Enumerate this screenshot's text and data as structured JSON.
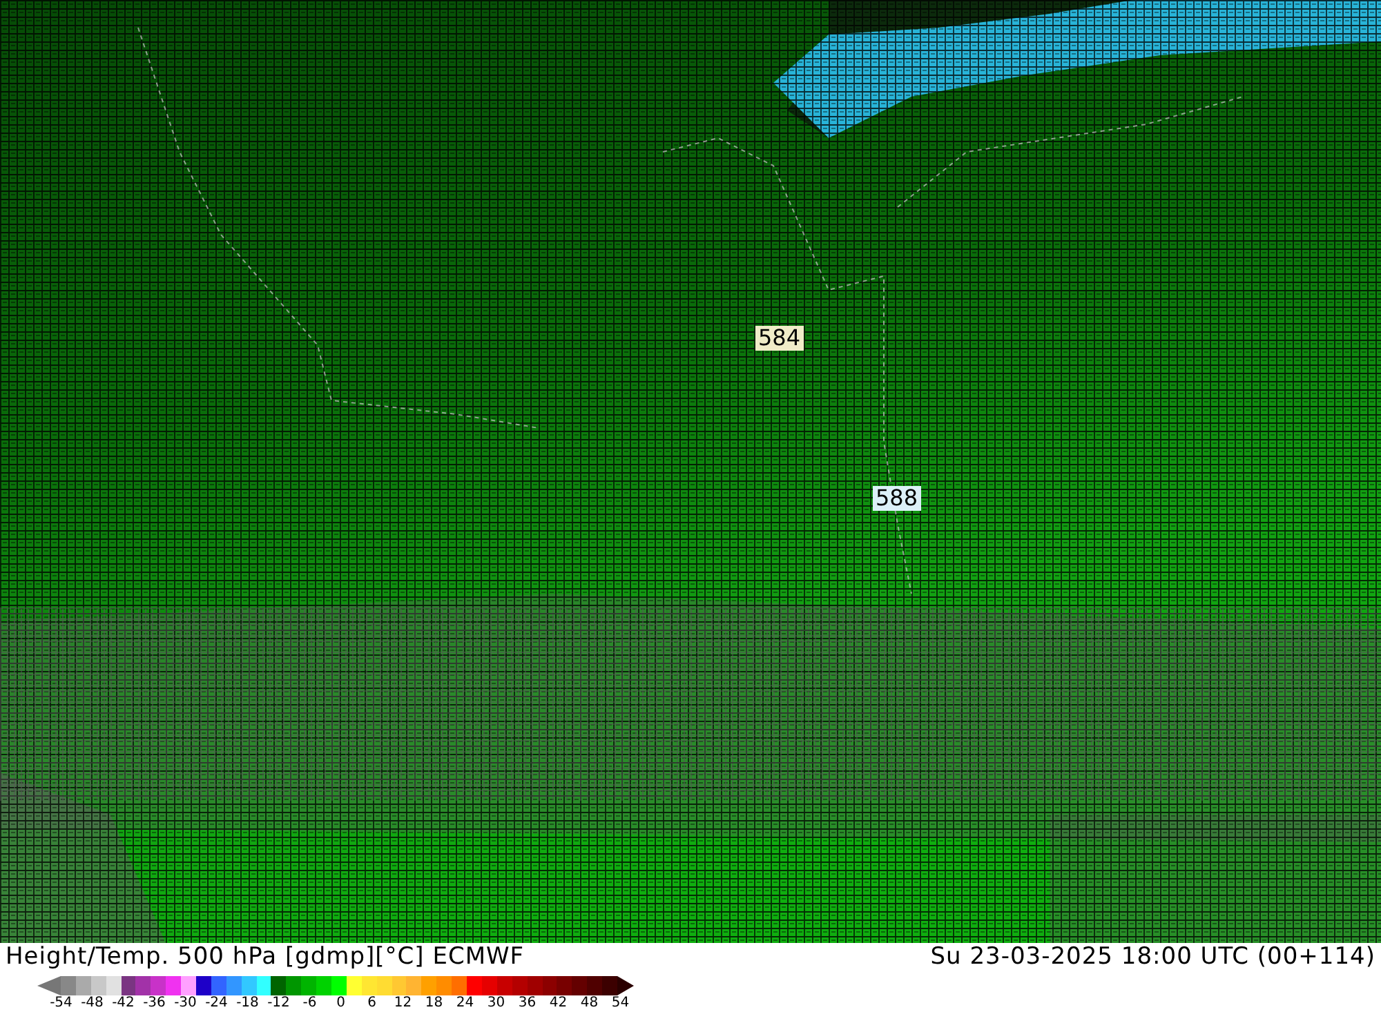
{
  "map": {
    "contour_labels": [
      {
        "text": "584",
        "color": "#f0ecc8"
      },
      {
        "text": "588",
        "color": "#dcf0f8"
      }
    ]
  },
  "footer": {
    "title": "Height/Temp. 500 hPa [gdmp][°C] ECMWF",
    "valid_time": "Su 23-03-2025 18:00 UTC (00+114)"
  },
  "colorbar": {
    "swatches": [
      {
        "kind": "arrow-left",
        "color": "#777777"
      },
      {
        "kind": "box",
        "color": "#888888"
      },
      {
        "kind": "box",
        "color": "#aaaaaa"
      },
      {
        "kind": "box",
        "color": "#c8c8c8"
      },
      {
        "kind": "box",
        "color": "#e1e1e1"
      },
      {
        "kind": "box",
        "color": "#7a3582"
      },
      {
        "kind": "box",
        "color": "#a232a8"
      },
      {
        "kind": "box",
        "color": "#c832c8"
      },
      {
        "kind": "box",
        "color": "#f032f0"
      },
      {
        "kind": "box",
        "color": "#ffa0ff"
      },
      {
        "kind": "box",
        "color": "#1e00c8"
      },
      {
        "kind": "box",
        "color": "#3264ff"
      },
      {
        "kind": "box",
        "color": "#3296ff"
      },
      {
        "kind": "box",
        "color": "#32c8ff"
      },
      {
        "kind": "box",
        "color": "#32ffff"
      },
      {
        "kind": "box",
        "color": "#006400"
      },
      {
        "kind": "box",
        "color": "#009600"
      },
      {
        "kind": "box",
        "color": "#00b400"
      },
      {
        "kind": "box",
        "color": "#00d200"
      },
      {
        "kind": "box",
        "color": "#00ff00"
      },
      {
        "kind": "box",
        "color": "#ffff32"
      },
      {
        "kind": "box",
        "color": "#ffe632"
      },
      {
        "kind": "box",
        "color": "#ffdc32"
      },
      {
        "kind": "box",
        "color": "#ffc832"
      },
      {
        "kind": "box",
        "color": "#ffb432"
      },
      {
        "kind": "box",
        "color": "#ffa000"
      },
      {
        "kind": "box",
        "color": "#ff8c00"
      },
      {
        "kind": "box",
        "color": "#ff6e00"
      },
      {
        "kind": "box",
        "color": "#ff0000"
      },
      {
        "kind": "box",
        "color": "#e60000"
      },
      {
        "kind": "box",
        "color": "#c80000"
      },
      {
        "kind": "box",
        "color": "#b40000"
      },
      {
        "kind": "box",
        "color": "#a00000"
      },
      {
        "kind": "box",
        "color": "#8c0000"
      },
      {
        "kind": "box",
        "color": "#780000"
      },
      {
        "kind": "box",
        "color": "#640000"
      },
      {
        "kind": "box",
        "color": "#500000"
      },
      {
        "kind": "box",
        "color": "#3c0000"
      },
      {
        "kind": "arrow-right",
        "color": "#2a0000"
      }
    ],
    "ticks": [
      "-54",
      "-48",
      "-42",
      "-36",
      "-30",
      "-24",
      "-18",
      "-12",
      "-6",
      "0",
      "6",
      "12",
      "18",
      "24",
      "30",
      "36",
      "42",
      "48",
      "54"
    ]
  }
}
